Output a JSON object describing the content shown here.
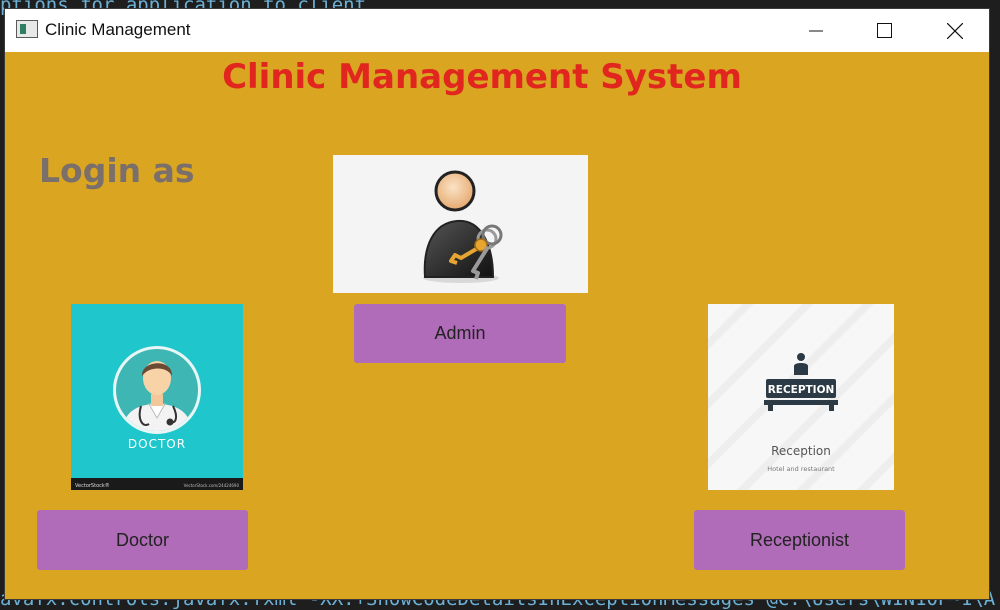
{
  "window": {
    "title": "Clinic Management"
  },
  "header": {
    "title": "Clinic Management System"
  },
  "login": {
    "label": "Login as"
  },
  "roles": {
    "admin": {
      "label": "Admin"
    },
    "doctor": {
      "label": "Doctor",
      "image_text": "DOCTOR",
      "watermark_left": "VectorStock®",
      "watermark_right": "VectorStock.com/24424690"
    },
    "receptionist": {
      "label": "Receptionist",
      "sign_text": "RECEPTION",
      "caption": "Reception",
      "subcaption": "Hotel and restaurant"
    }
  },
  "background_code": {
    "top": "ptions for application to client",
    "bottom": "avafx.controls.javafx.fxml  -XX:+ShowCodeDetailsInExceptionMessages  @C:\\Users\\WIN10P~1\\A"
  },
  "colors": {
    "window_bg": "#DAA520",
    "heading": "#e0261f",
    "login_text": "#7a6f6a",
    "button_bg": "#b06cb8"
  },
  "icons": [
    "app-icon",
    "minimize-icon",
    "maximize-icon",
    "close-icon",
    "admin-key-icon",
    "doctor-icon",
    "reception-icon"
  ]
}
